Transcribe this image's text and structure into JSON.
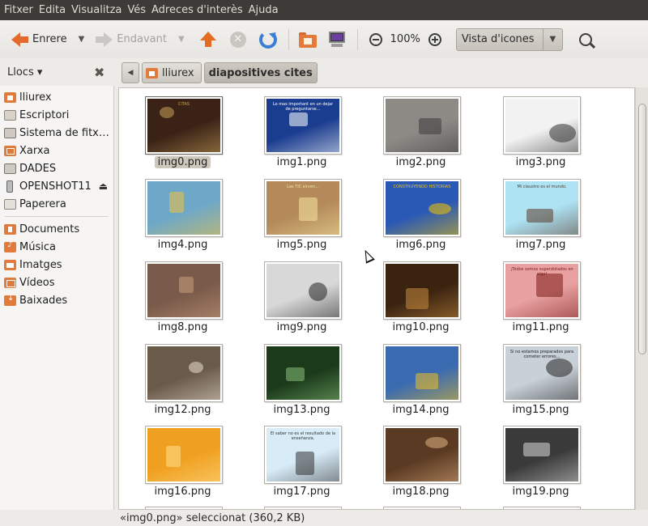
{
  "menubar": [
    "Fitxer",
    "Edita",
    "Visualitza",
    "Vés",
    "Adreces d'interès",
    "Ajuda"
  ],
  "toolbar": {
    "back_label": "Enrere",
    "forward_label": "Endavant",
    "zoom": "100%",
    "view_mode": "Vista d'icones"
  },
  "sidebar": {
    "title": "Llocs",
    "places": [
      {
        "label": "lliurex",
        "icon": "home-folder-icon"
      },
      {
        "label": "Escriptori",
        "icon": "folder-icon"
      },
      {
        "label": "Sistema de fitx…",
        "icon": "disk-icon"
      },
      {
        "label": "Xarxa",
        "icon": "network-icon"
      },
      {
        "label": "DADES",
        "icon": "disk-icon"
      },
      {
        "label": "OPENSHOT11",
        "icon": "usb-drive-icon"
      },
      {
        "label": "Paperera",
        "icon": "trash-icon"
      }
    ],
    "bookmarks": [
      {
        "label": "Documents",
        "icon": "documents-folder-icon"
      },
      {
        "label": "Música",
        "icon": "music-folder-icon"
      },
      {
        "label": "Imatges",
        "icon": "pictures-folder-icon"
      },
      {
        "label": "Vídeos",
        "icon": "videos-folder-icon"
      },
      {
        "label": "Baixades",
        "icon": "downloads-folder-icon"
      }
    ]
  },
  "pathbar": {
    "crumbs": [
      "lliurex",
      "diapositives cites"
    ]
  },
  "files": [
    {
      "name": "img0.png",
      "selected": true,
      "thumb": {
        "bg": "#3a2316",
        "fg": "#c9a25a",
        "text": "CITAS"
      }
    },
    {
      "name": "img1.png",
      "thumb": {
        "bg": "#1b3d8f",
        "fg": "#ffffff",
        "text": "Lo mas important en un dejar de preguntarse..."
      }
    },
    {
      "name": "img2.png",
      "thumb": {
        "bg": "#8d8a86",
        "fg": "#3a3a3a",
        "text": ""
      }
    },
    {
      "name": "img3.png",
      "thumb": {
        "bg": "#f2f2f2",
        "fg": "#333333",
        "text": ""
      }
    },
    {
      "name": "img4.png",
      "thumb": {
        "bg": "#6ea8c8",
        "fg": "#f0c040",
        "text": ""
      }
    },
    {
      "name": "img5.png",
      "thumb": {
        "bg": "#b48a5a",
        "fg": "#f5e6a0",
        "text": "Las TIC sirven..."
      }
    },
    {
      "name": "img6.png",
      "thumb": {
        "bg": "#2a59b5",
        "fg": "#f5c400",
        "text": "CONSTRUYENDO HISTORIAS"
      }
    },
    {
      "name": "img7.png",
      "thumb": {
        "bg": "#aee3f4",
        "fg": "#5a3a28",
        "text": "Mi claustro es el mundo."
      }
    },
    {
      "name": "img8.png",
      "thumb": {
        "bg": "#7a5a4a",
        "fg": "#c8a080",
        "text": ""
      }
    },
    {
      "name": "img9.png",
      "thumb": {
        "bg": "#d8d8d8",
        "fg": "#222222",
        "text": ""
      }
    },
    {
      "name": "img10.png",
      "thumb": {
        "bg": "#3a2410",
        "fg": "#c88a40",
        "text": ""
      }
    },
    {
      "name": "img11.png",
      "thumb": {
        "bg": "#e8a0a0",
        "fg": "#7a1a1a",
        "text": "¡Todos somos superdotados en algo!"
      }
    },
    {
      "name": "img12.png",
      "thumb": {
        "bg": "#6a5a4a",
        "fg": "#e8e0d0",
        "text": ""
      }
    },
    {
      "name": "img13.png",
      "thumb": {
        "bg": "#1a3a1a",
        "fg": "#8ac07a",
        "text": ""
      }
    },
    {
      "name": "img14.png",
      "thumb": {
        "bg": "#3a6ab0",
        "fg": "#f0c020",
        "text": ""
      }
    },
    {
      "name": "img15.png",
      "thumb": {
        "bg": "#c8d0d8",
        "fg": "#222222",
        "text": "Si no estamos preparados para cometer errores..."
      }
    },
    {
      "name": "img16.png",
      "thumb": {
        "bg": "#f0a020",
        "fg": "#ffe090",
        "text": ""
      }
    },
    {
      "name": "img17.png",
      "thumb": {
        "bg": "#d8ecf8",
        "fg": "#333333",
        "text": "El saber no es el resultado de la enseñanza."
      }
    },
    {
      "name": "img18.png",
      "thumb": {
        "bg": "#5a3a22",
        "fg": "#e0b080",
        "text": ""
      }
    },
    {
      "name": "img19.png",
      "thumb": {
        "bg": "#3a3a3a",
        "fg": "#d8d8d8",
        "text": ""
      }
    }
  ],
  "status": "«img0.png» seleccionat (360,2 KB)"
}
